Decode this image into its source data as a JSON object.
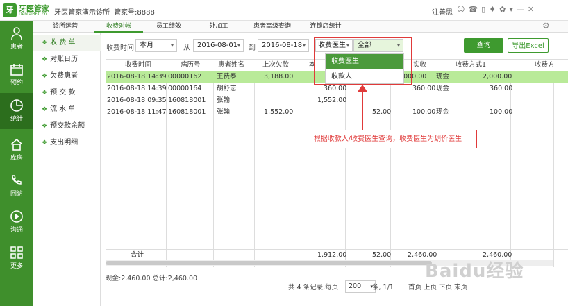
{
  "titlebar": {
    "logo_mark": "牙",
    "logo_name": "牙医管家",
    "logo_sub": "Dental360.cn",
    "title": "牙医管家演示诊所",
    "account": "管家号:8888",
    "user": "注善思"
  },
  "sidebar": {
    "items": [
      {
        "label": "患者",
        "icon": "person-icon"
      },
      {
        "label": "预约",
        "icon": "calendar-icon"
      },
      {
        "label": "统计",
        "icon": "pie-chart-icon"
      },
      {
        "label": "库房",
        "icon": "home-icon"
      },
      {
        "label": "回访",
        "icon": "phone-icon"
      },
      {
        "label": "沟通",
        "icon": "play-circle-icon"
      },
      {
        "label": "更多",
        "icon": "grid-icon"
      }
    ],
    "active": "统计"
  },
  "subnav": {
    "items": [
      "收 费 单",
      "对账日历",
      "欠费患者",
      "预 交 款",
      "流 水 单",
      "预交款余额",
      "支出明细"
    ]
  },
  "tabs": [
    "诊所运营",
    "收费对帐",
    "员工绩效",
    "外加工",
    "患者高级查询",
    "连锁店统计"
  ],
  "filter": {
    "time_label": "收费时间",
    "period": "本月",
    "from_label": "从",
    "from_date": "2016-08-01",
    "to_label": "到",
    "to_date": "2016-08-18",
    "type": "收费医生",
    "value": "全部",
    "query_btn": "查询",
    "export_btn": "导出Excel"
  },
  "dropdown": {
    "options": [
      "收费医生",
      "收款人"
    ]
  },
  "table": {
    "headers": [
      "收费时间",
      "病历号",
      "患者姓名",
      "上次欠款",
      "本",
      "实收",
      "收费方式1",
      "收费方"
    ],
    "rows": [
      {
        "time": "2016-08-18 14:39",
        "record": "00000162",
        "name": "王费泰",
        "last_debt": "3,188.00",
        "c5": "",
        "c6": "",
        "paid": "3,000.00",
        "method": "现金",
        "amount": "2,000.00"
      },
      {
        "time": "2016-08-18 14:39",
        "record": "00000164",
        "name": "胡舒志",
        "last_debt": "",
        "c5": "360.00",
        "c6": "",
        "paid": "360.00",
        "method": "现金",
        "amount": "360.00"
      },
      {
        "time": "2016-08-18 09:35",
        "record": "160818001",
        "name": "张翰",
        "last_debt": "",
        "c5": "1,552.00",
        "c6": "",
        "paid": "",
        "method": "",
        "amount": ""
      },
      {
        "time": "2016-08-18 11:47",
        "record": "160818001",
        "name": "张翰",
        "last_debt": "1,552.00",
        "c5": "",
        "c6": "52.00",
        "paid": "100.00",
        "method": "现金",
        "amount": "100.00"
      }
    ],
    "total": {
      "label": "合计",
      "c5": "1,912.00",
      "c6": "52.00",
      "paid": "2,460.00",
      "amount": "2,460.00"
    }
  },
  "summary": "现金:2,460.00  总计:2,460.00",
  "pager": {
    "info": "共 4 条记录,每页",
    "size": "200",
    "after": "条,   1/1",
    "nav": "首页 上页 下页 末页"
  },
  "callout": "根据收款人/收费医生查询，收费医生为划价医生",
  "watermark": "Baidu经验",
  "colors": {
    "brand": "#3e9a2f",
    "highlight": "#b9ea99",
    "annotation": "#e03a3a"
  }
}
